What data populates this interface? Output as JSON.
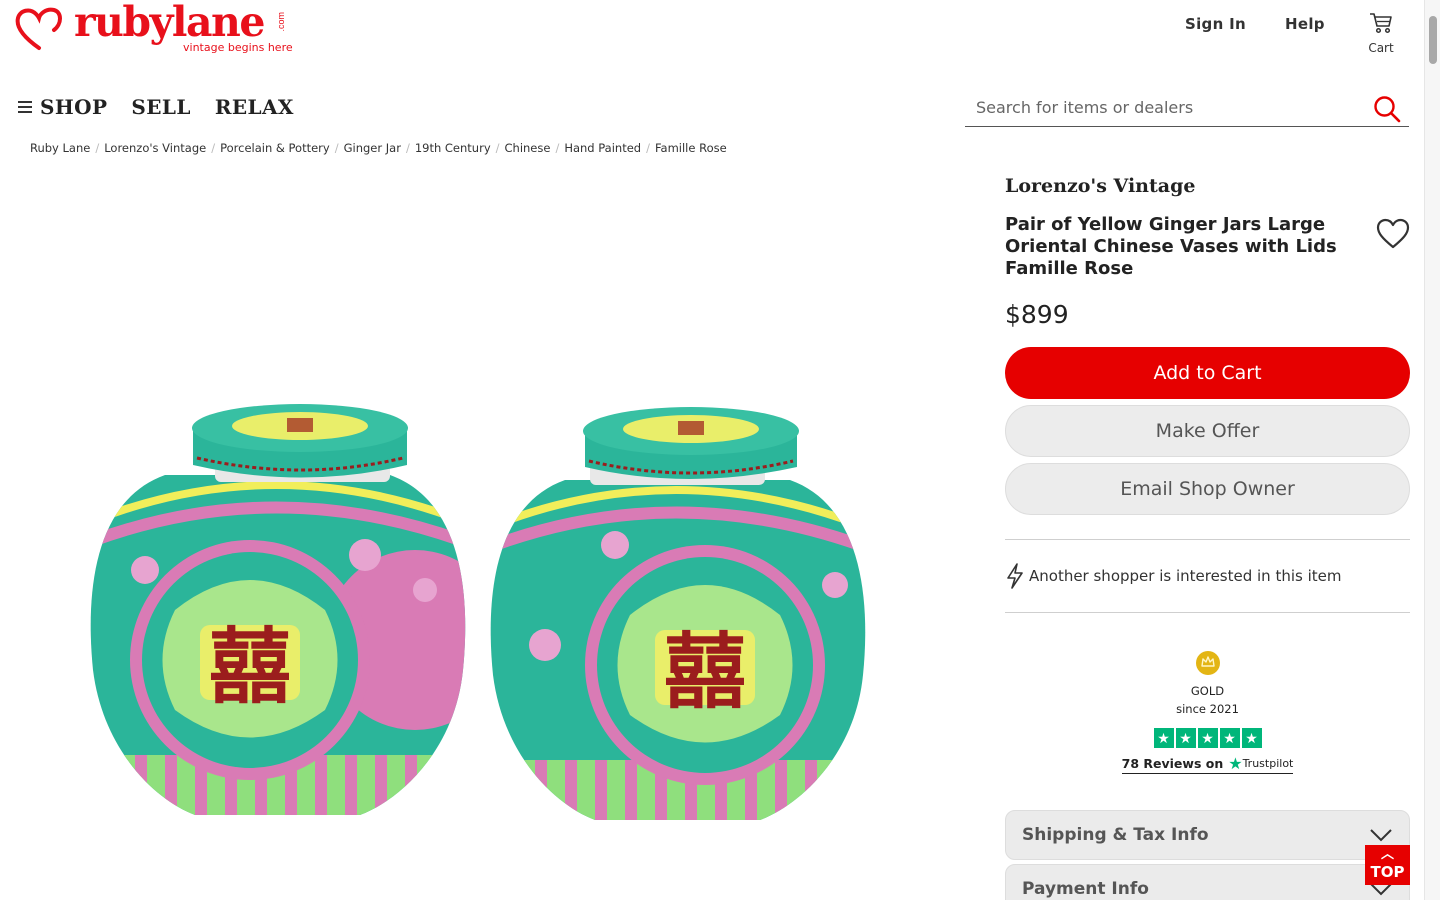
{
  "brand": {
    "name": "rubylane",
    "tagline": "vintage begins here",
    "tld": ".com",
    "color": "#e8101b"
  },
  "header": {
    "sign_in": "Sign In",
    "help": "Help",
    "cart_label": "Cart"
  },
  "nav": {
    "items": [
      {
        "label": "SHOP"
      },
      {
        "label": "SELL"
      },
      {
        "label": "RELAX"
      }
    ]
  },
  "search": {
    "placeholder": "Search for items or dealers",
    "value": ""
  },
  "breadcrumb": [
    "Ruby Lane",
    "Lorenzo's Vintage",
    "Porcelain & Pottery",
    "Ginger Jar",
    "19th Century",
    "Chinese",
    "Hand Painted",
    "Famille Rose"
  ],
  "product": {
    "shop_name": "Lorenzo's Vintage",
    "title": "Pair of Yellow Ginger Jars Large Oriental Chinese Vases with Lids Famille Rose",
    "price": "$899",
    "add_to_cart": "Add to Cart",
    "make_offer": "Make Offer",
    "email_owner": "Email Shop Owner",
    "interest_note": "Another shopper is interested in this item"
  },
  "seller_badge": {
    "level": "GOLD",
    "since": "since 2021",
    "reviews_text": "78 Reviews on",
    "trustpilot": "Trustpilot",
    "rating_stars": 5
  },
  "accordions": [
    {
      "label": "Shipping & Tax Info"
    },
    {
      "label": "Payment Info"
    }
  ],
  "back_to_top": "TOP",
  "colors": {
    "accent": "#e60000",
    "trustpilot": "#00b67a",
    "jar_teal": "#2bb59a",
    "jar_pink": "#d97bb5",
    "jar_yellow": "#e9ee6a"
  },
  "icons": [
    "heart-logo-icon",
    "cart-icon",
    "hamburger-icon",
    "search-icon",
    "favorite-heart-icon",
    "lightning-icon",
    "crown-icon",
    "star-icon",
    "chevron-down-icon",
    "chevron-up-icon"
  ]
}
